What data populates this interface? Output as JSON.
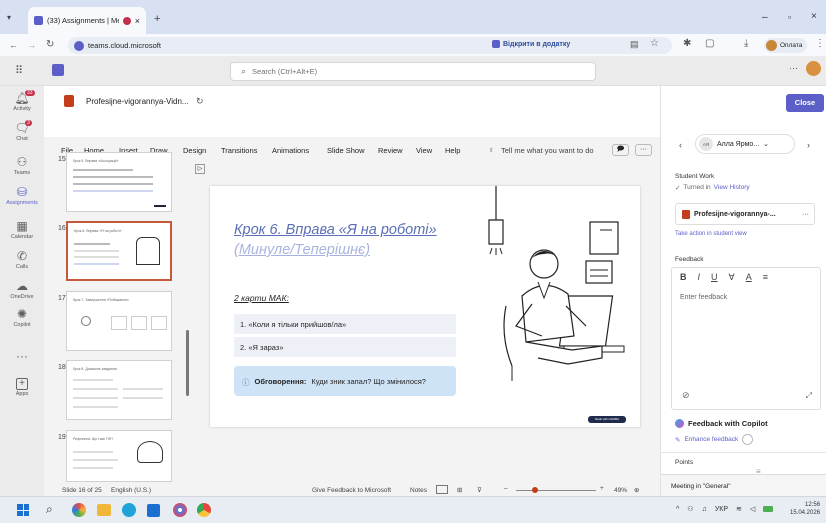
{
  "browser": {
    "tab_title": "(33) Assignments | Meeting",
    "url": "teams.cloud.microsoft",
    "install_label": "Відкрити в додатку",
    "profile_label": "Оплата",
    "colors": {
      "tabbar": "#d7e1f1",
      "accent": "#5b5fc7"
    }
  },
  "teams": {
    "search_placeholder": "Search (Ctrl+Alt+E)",
    "rail": [
      {
        "label": "Activity",
        "badge": "33",
        "icon": "bell-icon"
      },
      {
        "label": "Chat",
        "badge": "3",
        "icon": "chat-icon"
      },
      {
        "label": "Teams",
        "icon": "teams-icon"
      },
      {
        "label": "Assignments",
        "icon": "assignments-icon"
      },
      {
        "label": "Calendar",
        "icon": "calendar-icon"
      },
      {
        "label": "Calls",
        "icon": "phone-icon"
      },
      {
        "label": "OneDrive",
        "icon": "cloud-icon"
      },
      {
        "label": "Copilot",
        "icon": "copilot-icon"
      },
      {
        "label": "Apps",
        "icon": "plus-icon"
      }
    ]
  },
  "ppt": {
    "file_title": "Profesijne-vigorannya-Vidn...",
    "menu": [
      "File",
      "Home",
      "Insert",
      "Draw",
      "Design",
      "Transitions",
      "Animations",
      "Slide Show",
      "Review",
      "View",
      "Help"
    ],
    "tell_me": "Tell me what you want to do",
    "thumbnails": [
      {
        "num": "15",
        "title": "Крок 5. Вправа «Ассоціації»"
      },
      {
        "num": "16",
        "title": "Крок 6. Вправа «Я на роботі»"
      },
      {
        "num": "17",
        "title": "Крок 7. Завершення «Побажання»"
      },
      {
        "num": "18",
        "title": "Крок 8. Домашнє завдання"
      },
      {
        "num": "19",
        "title": "Рефлексія: Що таке ПФ?"
      }
    ],
    "slide": {
      "title_line1": "Крок 6. Вправа «Я на роботі»",
      "title_line2": "(Минуле/Теперішнє)",
      "subtitle": "2 карти МАК:",
      "item1": "1. «Коли я тільки прийшов/ла»",
      "item2": "2. «Я зараз»",
      "discussion_bold": "Обговорення:",
      "discussion_text": "Куди зник запал? Що змінилося?",
      "badge": "Made with GAMMA"
    },
    "status": {
      "slide_info": "Slide 16 of 25",
      "language": "English (U.S.)",
      "feedback": "Give Feedback to Microsoft",
      "notes": "Notes",
      "zoom": "49%"
    }
  },
  "panel": {
    "close_label": "Close",
    "student_name": "Алла Ярмо...",
    "student_initials": "АЯ",
    "student_work_label": "Student Work",
    "turned_in": "Turned in",
    "view_history": "View History",
    "file_name": "Profesijne-vigorannya-...",
    "take_action": "Take action in student view",
    "feedback_label": "Feedback",
    "feedback_placeholder": "Enter feedback",
    "copilot_label": "Feedback with Copilot",
    "enhance_label": "Enhance feedback",
    "points_label": "Points",
    "meeting_label": "Meeting in \"General\""
  },
  "taskbar": {
    "lang": "УКР",
    "time": "12:56",
    "date": "15.04.2026"
  }
}
